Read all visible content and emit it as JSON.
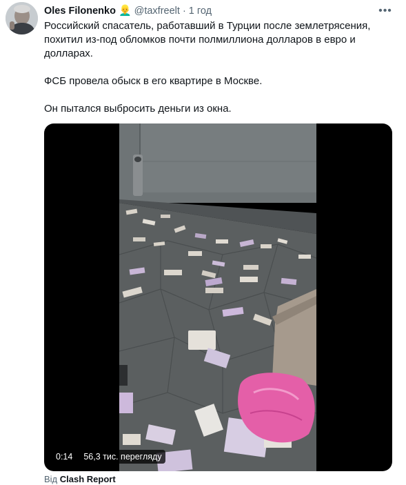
{
  "author": {
    "name": "Oles Filonenko",
    "emoji": "👱‍♂️",
    "handle": "@taxfreelt",
    "separator": "·",
    "time": "1 год"
  },
  "more_label": "•••",
  "tweet_text": {
    "paragraph1": "Российский спасатель, работавший в Турции после землетрясения, похитил из-под обломков почти полмиллиона долларов в евро и долларах.",
    "paragraph2": "ФСБ провела обыск в его квартире в Москве.",
    "paragraph3": "Он пытался выбросить деньги из окна."
  },
  "video": {
    "duration": "0:14",
    "views": "56,3 тис. перегляду"
  },
  "source": {
    "prefix": "Від",
    "name": "Clash Report"
  }
}
